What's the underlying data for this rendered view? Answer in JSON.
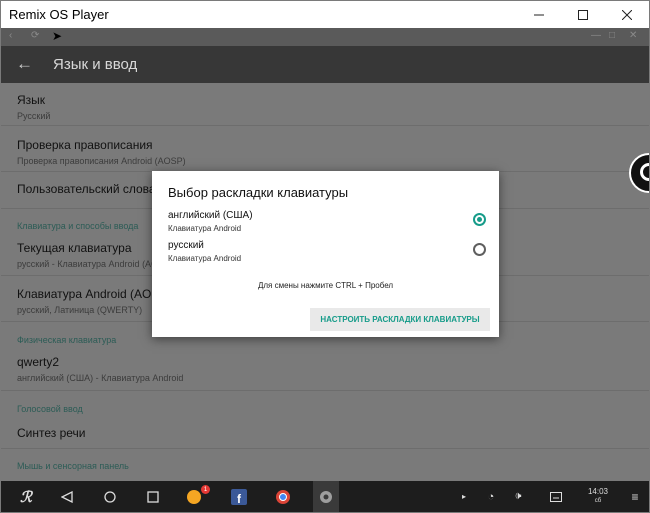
{
  "window": {
    "title": "Remix OS Player"
  },
  "appbar": {
    "title": "Язык и ввод"
  },
  "settings": {
    "language": {
      "title": "Язык",
      "summary": "Русский"
    },
    "spellcheck": {
      "title": "Проверка правописания",
      "summary": "Проверка правописания Android (AOSP)"
    },
    "user_dictionary": {
      "title": "Пользовательский словарь"
    },
    "section_keyboard": "Клавиатура и способы ввода",
    "current_keyboard": {
      "title": "Текущая клавиатура",
      "summary": "русский - Клавиатура Android (AOSP)"
    },
    "android_keyboard": {
      "title": "Клавиатура Android (AOSP)",
      "summary": "русский, Латиница (QWERTY)"
    },
    "section_physical": "Физическая клавиатура",
    "physical": {
      "title": "qwerty2",
      "summary": "английский (США) - Клавиатура Android"
    },
    "section_voice": "Голосовой ввод",
    "speech": {
      "title": "Синтез речи"
    },
    "section_mouse": "Мышь и сенсорная панель"
  },
  "dialog": {
    "title": "Выбор раскладки клавиатуры",
    "options": [
      {
        "label": "английский (США)",
        "sub": "Клавиатура Android",
        "selected": true
      },
      {
        "label": "русский",
        "sub": "Клавиатура Android",
        "selected": false
      }
    ],
    "hint": "Для смены нажмите CTRL + Пробел",
    "button": "НАСТРОИТЬ РАСКЛАДКИ КЛАВИАТУРЫ"
  },
  "taskbar": {
    "badge_count": "1",
    "time": "14:03",
    "day": "сб"
  },
  "colors": {
    "accent": "#179c8a",
    "appbar": "#373737",
    "dim": "#7a7a7a",
    "taskbar": "#1d1d1d"
  }
}
